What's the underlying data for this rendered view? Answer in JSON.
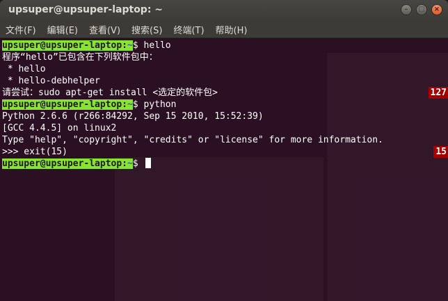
{
  "window": {
    "title": "upsuper@upsuper-laptop: ~",
    "buttons": {
      "minimize": "–",
      "maximize": "□",
      "close": "×"
    }
  },
  "menu": {
    "items": [
      {
        "label": "文件(F)"
      },
      {
        "label": "编辑(E)"
      },
      {
        "label": "查看(V)"
      },
      {
        "label": "搜索(S)"
      },
      {
        "label": "终端(T)"
      },
      {
        "label": "帮助(H)"
      }
    ]
  },
  "terminal": {
    "prompt_user": "upsuper@upsuper-laptop:",
    "prompt_path": "~",
    "prompt_dollar": "$",
    "lines": [
      {
        "kind": "prompt",
        "command": " hello"
      },
      {
        "kind": "text",
        "text": "程序“hello”已包含在下列软件包中："
      },
      {
        "kind": "text",
        "text": " * hello"
      },
      {
        "kind": "text",
        "text": " * hello-debhelper"
      },
      {
        "kind": "text",
        "text": "请尝试：sudo apt-get install <选定的软件包>"
      },
      {
        "kind": "prompt",
        "command": " python"
      },
      {
        "kind": "text",
        "text": "Python 2.6.6 (r266:84292, Sep 15 2010, 15:52:39)"
      },
      {
        "kind": "text",
        "text": "[GCC 4.4.5] on linux2"
      },
      {
        "kind": "text",
        "text": "Type \"help\", \"copyright\", \"credits\" or \"license\" for more information."
      },
      {
        "kind": "text",
        "text": ">>> exit(15)"
      },
      {
        "kind": "prompt",
        "command": " "
      }
    ],
    "exit_codes": [
      {
        "after_line": 4,
        "code": "127"
      },
      {
        "after_line": 9,
        "code": "15"
      }
    ]
  },
  "colors": {
    "prompt_bg": "#8ae234",
    "path": "#3465a4",
    "exit_badge": "#a40000",
    "terminal_bg": "#300a24"
  }
}
